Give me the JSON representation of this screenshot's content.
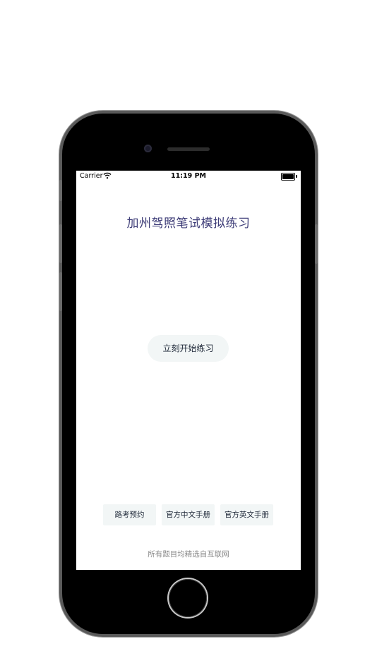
{
  "status_bar": {
    "carrier": "Carrier",
    "time": "11:19 PM",
    "wifi_icon": "wifi-icon",
    "battery_icon": "battery-icon"
  },
  "main": {
    "title": "加州驾照笔试模拟练习",
    "start_button_label": "立刻开始练习"
  },
  "links": [
    {
      "label": "路考预约"
    },
    {
      "label": "官方中文手册"
    },
    {
      "label": "官方英文手册"
    }
  ],
  "footer": {
    "note": "所有题目均精选自互联网"
  },
  "colors": {
    "title": "#3e3d78",
    "button_bg": "#f2f6f6",
    "footer_text": "#8a8a8a"
  }
}
